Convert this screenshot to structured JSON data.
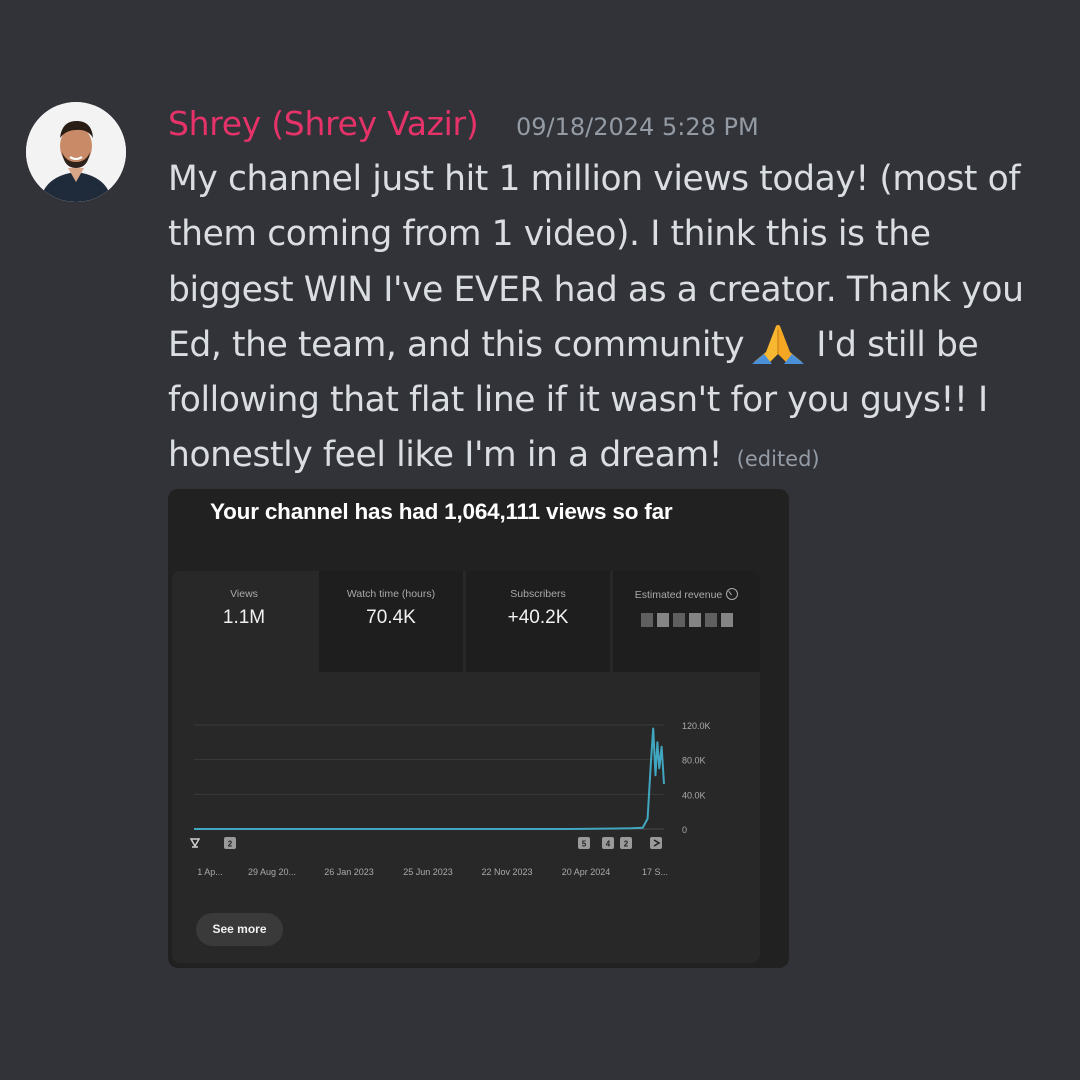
{
  "message": {
    "author": "Shrey (Shrey Vazir)",
    "timestamp": "09/18/2024 5:28 PM",
    "lines": [
      "My channel just hit 1 million views today! (most of",
      "them coming from 1 video). I think this is the",
      "biggest WIN I've EVER had as a creator. Thank you",
      "Ed, the team, and this community",
      "I'd still be",
      "following that flat line if it wasn't for you guys!! I",
      "honestly feel like I'm in a dream!"
    ],
    "emoji": "folded-hands",
    "edited_label": "(edited)",
    "author_color": "#e5336a"
  },
  "embed": {
    "title": "Your channel has had 1,064,111 views so far",
    "metrics": [
      {
        "label": "Views",
        "value": "1.1M"
      },
      {
        "label": "Watch time (hours)",
        "value": "70.4K"
      },
      {
        "label": "Subscribers",
        "value": "+40.2K"
      },
      {
        "label": "Estimated revenue",
        "value": ""
      }
    ],
    "see_more_label": "See more",
    "line_color": "#41a7c0"
  },
  "chart_data": {
    "type": "line",
    "x_tick_labels": [
      "1 Ap...",
      "29 Aug 20...",
      "26 Jan 2023",
      "25 Jun 2023",
      "22 Nov 2023",
      "20 Apr 2024",
      "17 S..."
    ],
    "y_tick_labels": [
      "120.0K",
      "80.0K",
      "40.0K",
      "0"
    ],
    "ylim": [
      0,
      120000
    ],
    "markers": [
      "2",
      "5",
      "4",
      "2"
    ],
    "series": [
      {
        "points": [
          [
            0,
            0
          ],
          [
            0.05,
            0
          ],
          [
            0.1,
            0
          ],
          [
            0.2,
            0
          ],
          [
            0.3,
            0
          ],
          [
            0.4,
            0
          ],
          [
            0.5,
            0
          ],
          [
            0.6,
            0
          ],
          [
            0.7,
            0
          ],
          [
            0.8,
            0
          ],
          [
            0.85,
            400
          ],
          [
            0.9,
            600
          ],
          [
            0.93,
            800
          ],
          [
            0.955,
            1500
          ],
          [
            0.965,
            12000
          ],
          [
            0.972,
            75000
          ],
          [
            0.977,
            116000
          ],
          [
            0.982,
            62000
          ],
          [
            0.986,
            100000
          ],
          [
            0.99,
            70000
          ],
          [
            0.995,
            95000
          ],
          [
            1,
            52000
          ]
        ]
      }
    ]
  }
}
